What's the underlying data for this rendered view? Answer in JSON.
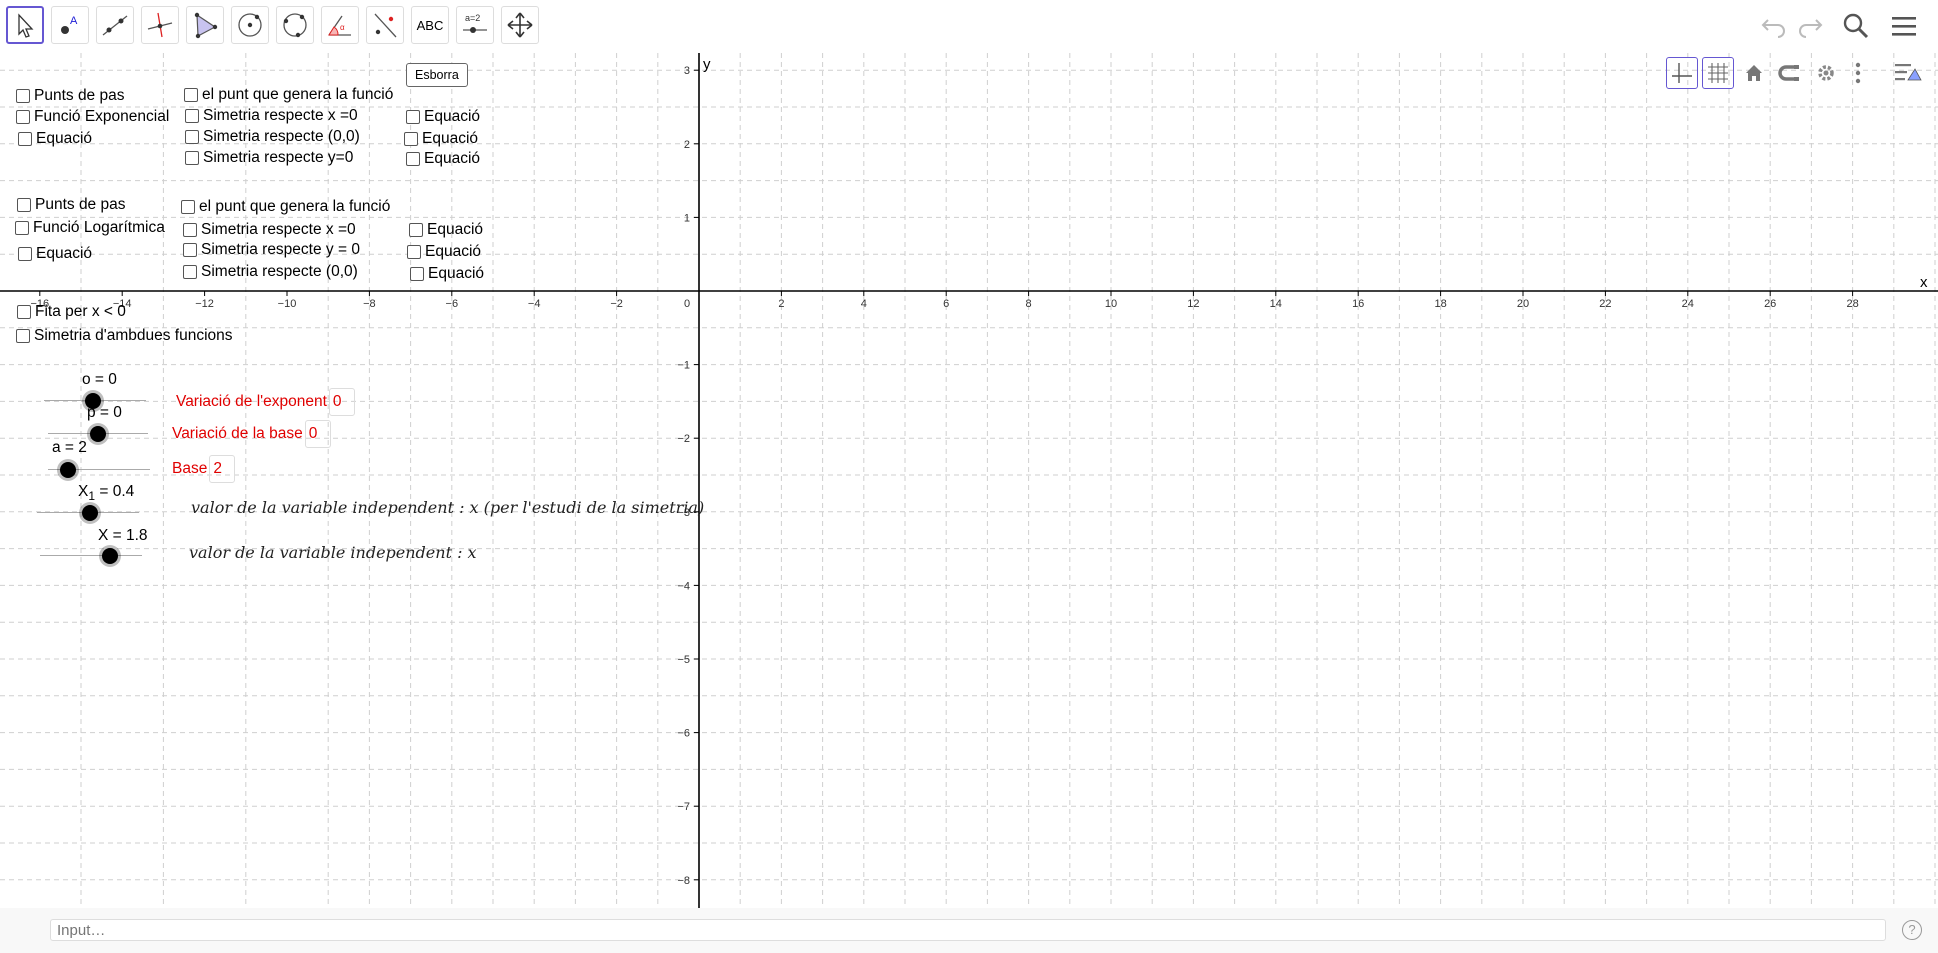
{
  "toolbar": {
    "tools": [
      "move-tool-icon",
      "point-tool-icon",
      "line-tool-icon",
      "perpendicular-line-tool-icon",
      "polygon-tool-icon",
      "circle-center-point-tool-icon",
      "circle-three-points-tool-icon",
      "angle-tool-icon",
      "reflect-tool-icon",
      "text-tool-icon",
      "slider-tool-icon",
      "move-graphics-view-tool-icon"
    ],
    "text_tool_label": "ABC",
    "slider_tool_label": "a=2"
  },
  "graphics": {
    "esborra_button": "Esborra",
    "axis_x_label": "x",
    "axis_y_label": "y",
    "x_ticks": [
      "−16",
      "−14",
      "−12",
      "−10",
      "−8",
      "−6",
      "−4",
      "−2",
      "0",
      "2",
      "4",
      "6",
      "8",
      "10",
      "12",
      "14",
      "16",
      "18",
      "20",
      "22",
      "24",
      "26",
      "28"
    ],
    "y_ticks_pos": [
      "3",
      "2",
      "1"
    ],
    "y_ticks_neg": [
      "−1",
      "−2",
      "−3",
      "−4",
      "−5",
      "−6",
      "−7",
      "−8"
    ],
    "group_exp": {
      "col1": [
        "Punts de pas",
        "Funció Exponencial",
        "Equació"
      ],
      "col2": [
        "el punt que genera la funció",
        "Simetria respecte x =0",
        "Simetria respecte (0,0)",
        "Simetria respecte y=0"
      ],
      "col3": [
        "Equació",
        "Equació",
        "Equació"
      ]
    },
    "group_log": {
      "col1": [
        "Punts de pas",
        "Funció Logarítmica",
        "Equació"
      ],
      "col2": [
        "el punt que genera la funció",
        "Simetria respecte x =0",
        "Simetria respecte y = 0",
        "Simetria respecte (0,0)"
      ],
      "col3": [
        "Equació",
        "Equació",
        "Equació"
      ]
    },
    "fita_label": "Fita per x < 0",
    "simetria_label": "Simetria d'ambdues funcions",
    "sliders": [
      {
        "label": "o = 0",
        "value": 0
      },
      {
        "label": "p = 0",
        "value": 0
      },
      {
        "label": "a = 2",
        "value": 2
      },
      {
        "label": "X",
        "sub": "1",
        "suffix": " = 0.4",
        "value": 0.4
      },
      {
        "label": "X = 1.8",
        "value": 1.8
      }
    ],
    "inputs": {
      "exponent_label": "Variació de l'exponent",
      "exponent_value": "0",
      "base_var_label": "Variació de la base",
      "base_var_value": "0",
      "base_label": "Base",
      "base_value": "2"
    },
    "text1": "valor de la variable independent :  x (per l'estudi de la simetria)",
    "text2": "valor de la variable independent :  x"
  },
  "input_bar": {
    "placeholder": "Input…",
    "help": "?"
  },
  "colors": {
    "accent": "#6557d2",
    "red": "#e00000",
    "grid": "#c8c8c8"
  }
}
